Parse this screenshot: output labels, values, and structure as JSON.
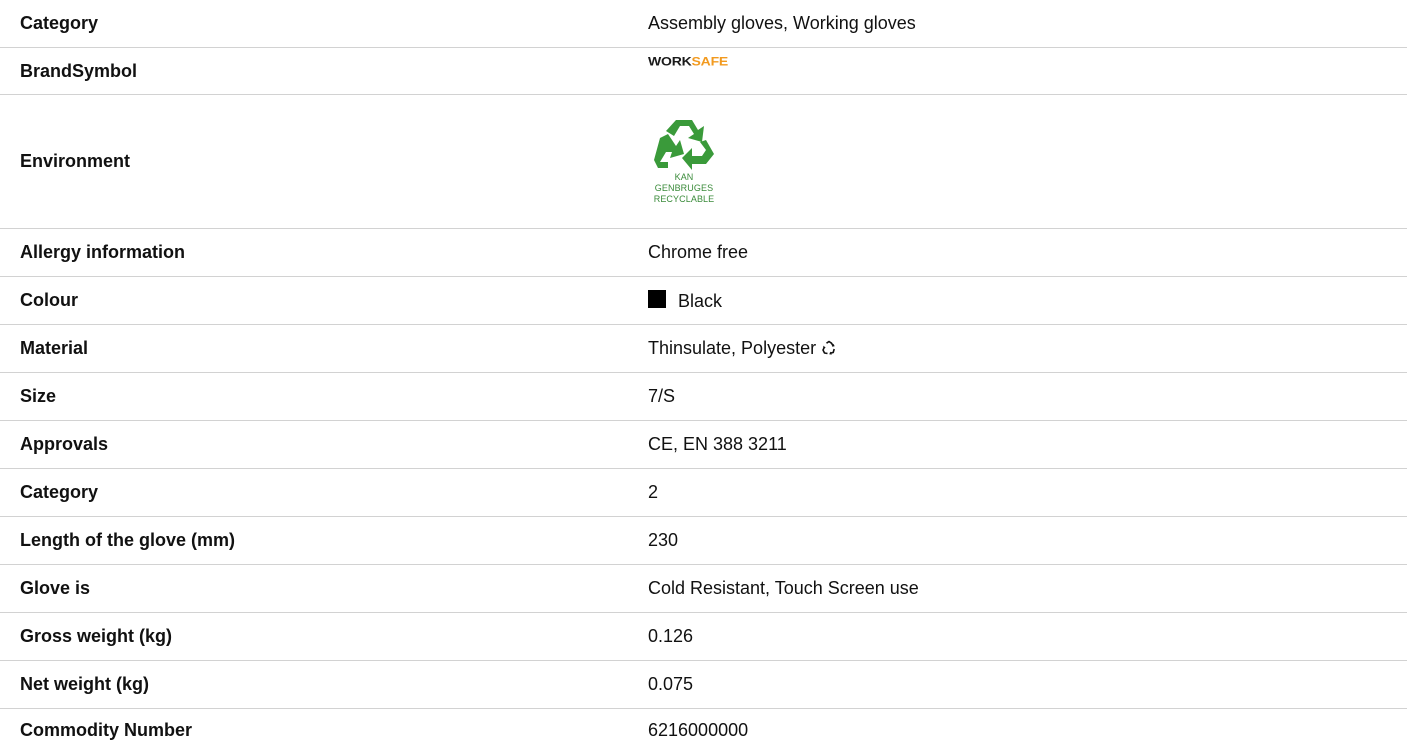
{
  "colors": {
    "swatch": "#000000",
    "brand_work": "#1a1a1a",
    "brand_safe": "#f29a1f",
    "recycle_green": "#3a8b3a"
  },
  "rows": [
    {
      "label": "Category",
      "value": "Assembly gloves, Working gloves"
    },
    {
      "label": "BrandSymbol",
      "brand_logo": {
        "part1": "WORK",
        "part2": "SAFE"
      }
    },
    {
      "label": "Environment",
      "badge": {
        "icon": "recycle-icon",
        "line1": "KAN",
        "line2": "GENBRUGES",
        "line3": "RECYCLABLE"
      }
    },
    {
      "label": "Allergy information",
      "value": "Chrome free"
    },
    {
      "label": "Colour",
      "value": "Black",
      "swatch_icon": "color-swatch-icon"
    },
    {
      "label": "Material",
      "value": "Thinsulate, Polyester",
      "value_icon": "recycle-icon"
    },
    {
      "label": "Size",
      "value": "7/S"
    },
    {
      "label": "Approvals",
      "value": "CE, EN 388 3211"
    },
    {
      "label": "Category",
      "value": "2"
    },
    {
      "label": "Length of the glove (mm)",
      "value": "230"
    },
    {
      "label": "Glove is",
      "value": "Cold Resistant, Touch Screen use"
    },
    {
      "label": "Gross weight (kg)",
      "value": "0.126"
    },
    {
      "label": "Net weight (kg)",
      "value": "0.075"
    },
    {
      "label": "Commodity Number",
      "value": "6216000000"
    }
  ]
}
